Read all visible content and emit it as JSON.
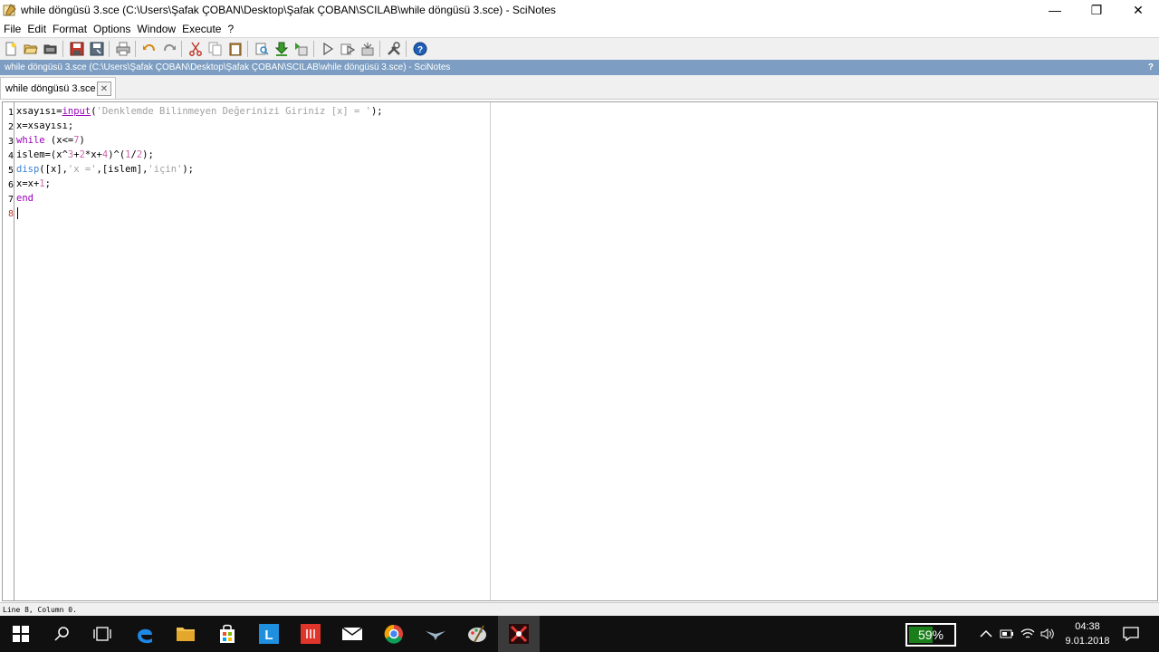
{
  "window": {
    "title": "while döngüsü 3.sce (C:\\Users\\Şafak ÇOBAN\\Desktop\\Şafak ÇOBAN\\SCILAB\\while döngüsü 3.sce) - SciNotes",
    "minimize_symbol": "—",
    "restore_symbol": "❐",
    "close_symbol": "✕"
  },
  "menu": {
    "items": [
      "File",
      "Edit",
      "Format",
      "Options",
      "Window",
      "Execute",
      "?"
    ]
  },
  "pathbar": {
    "text": "while döngüsü 3.sce (C:\\Users\\Şafak ÇOBAN\\Desktop\\Şafak ÇOBAN\\SCILAB\\while döngüsü 3.sce) - SciNotes",
    "help": "?"
  },
  "tab": {
    "label": "while döngüsü 3.sce",
    "close_symbol": "✕"
  },
  "editor": {
    "line_numbers": [
      "1",
      "2",
      "3",
      "4",
      "5",
      "6",
      "7",
      "8"
    ],
    "lines": [
      "xsayısı=input('Denklemde Bilinmeyen Değerinizi Giriniz [x] = ');",
      "x=xsayısı;",
      "while (x<=7)",
      "islem=(x^3+2*x+4)^(1/2);",
      "disp([x],'x =',[islem],'için');",
      "x=x+1;",
      "end",
      ""
    ]
  },
  "status": {
    "text": "Line 8, Column 0."
  },
  "taskbar": {
    "battery_percent": "59%",
    "clock_time": "04:38",
    "clock_date": "9.01.2018"
  },
  "colors": {
    "pathbar": "#7d9ec2",
    "keyword": "#9900bb",
    "string": "#a0a0a0"
  }
}
